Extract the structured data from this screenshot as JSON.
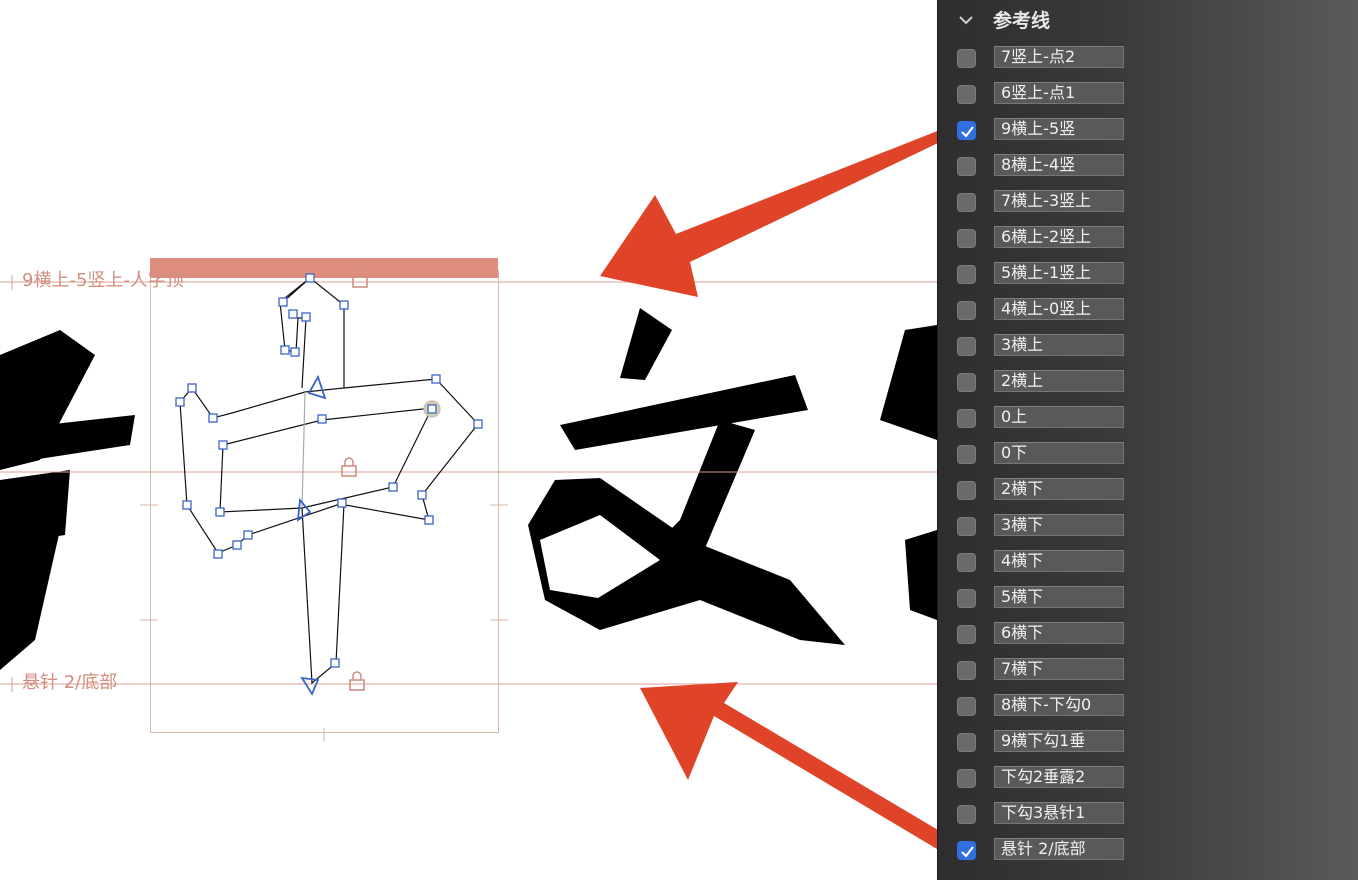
{
  "canvas": {
    "guides": {
      "top_label": "9横上-5竖上-人字顶",
      "bottom_label": "悬针 2/底部"
    },
    "glyphs": [
      "中",
      "文"
    ],
    "colors": {
      "guide": "#d28f80",
      "node": "#3a64c8",
      "arrow": "#e04428",
      "highlight_bar": "#de8d7e"
    }
  },
  "panel": {
    "title": "参考线",
    "items": [
      {
        "label": "7竖上-点2",
        "checked": false
      },
      {
        "label": "6竖上-点1",
        "checked": false
      },
      {
        "label": "9横上-5竖",
        "checked": true
      },
      {
        "label": "8横上-4竖",
        "checked": false
      },
      {
        "label": "7横上-3竖上",
        "checked": false
      },
      {
        "label": "6横上-2竖上",
        "checked": false
      },
      {
        "label": "5横上-1竖上",
        "checked": false
      },
      {
        "label": "4横上-0竖上",
        "checked": false
      },
      {
        "label": "3横上",
        "checked": false
      },
      {
        "label": "2横上",
        "checked": false
      },
      {
        "label": "0上",
        "checked": false
      },
      {
        "label": "0下",
        "checked": false
      },
      {
        "label": "2横下",
        "checked": false
      },
      {
        "label": "3横下",
        "checked": false
      },
      {
        "label": "4横下",
        "checked": false
      },
      {
        "label": "5横下",
        "checked": false
      },
      {
        "label": "6横下",
        "checked": false
      },
      {
        "label": "7横下",
        "checked": false
      },
      {
        "label": "8横下-下勾0",
        "checked": false
      },
      {
        "label": "9横下勾1垂",
        "checked": false
      },
      {
        "label": "下勾2垂露2",
        "checked": false
      },
      {
        "label": "下勾3悬针1",
        "checked": false
      },
      {
        "label": "悬针 2/底部",
        "checked": true
      }
    ]
  }
}
